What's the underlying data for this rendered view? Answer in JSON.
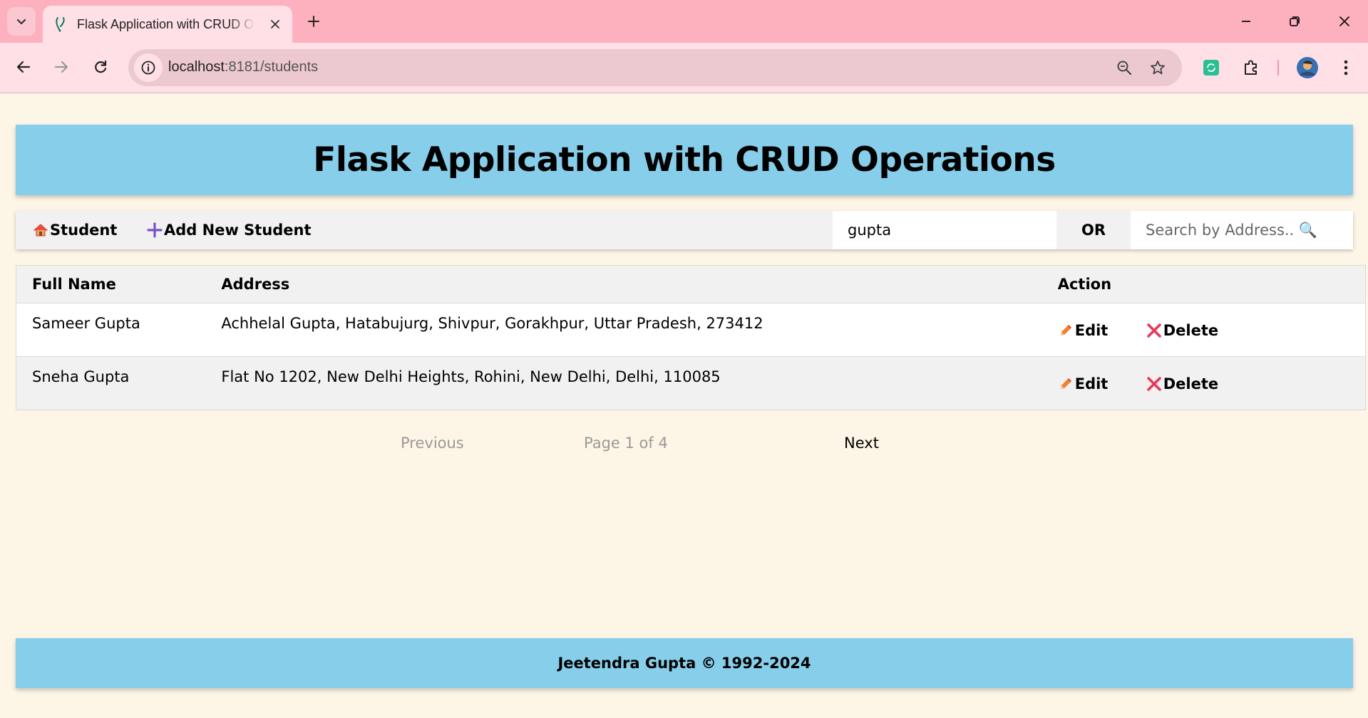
{
  "browser": {
    "tab": {
      "title": "Flask Application with CRUD Operations"
    },
    "url": {
      "host": "localhost",
      "path": ":8181/students"
    }
  },
  "page": {
    "header_title": "Flask Application with CRUD Operations",
    "nav": {
      "student_icon": "house-icon",
      "student_label": "Student",
      "add_icon": "plus-icon",
      "add_label": "Add New Student",
      "search_name_value": "gupta",
      "or_label": "OR",
      "search_address_placeholder": "Search by Address.. 🔍"
    },
    "table": {
      "headers": [
        "Full Name",
        "Address",
        "Action"
      ],
      "rows": [
        {
          "full_name": "Sameer Gupta",
          "address": "Achhelal Gupta, Hatabujurg, Shivpur, Gorakhpur, Uttar Pradesh, 273412",
          "edit_label": "Edit",
          "delete_label": "Delete"
        },
        {
          "full_name": "Sneha Gupta",
          "address": "Flat No 1202, New Delhi Heights, Rohini, New Delhi, Delhi, 110085",
          "edit_label": "Edit",
          "delete_label": "Delete"
        }
      ]
    },
    "pagination": {
      "previous_label": "Previous",
      "page_info": "Page 1 of 4",
      "next_label": "Next"
    },
    "footer_text": "Jeetendra Gupta © 1992-2024"
  },
  "colors": {
    "tabstrip": "#fdb0be",
    "toolbar": "#ffe0e6",
    "page_background": "#fdf6e6",
    "header_background": "#87ceeb",
    "edit_icon": "#f4802a",
    "delete_icon": "#e8375c"
  }
}
